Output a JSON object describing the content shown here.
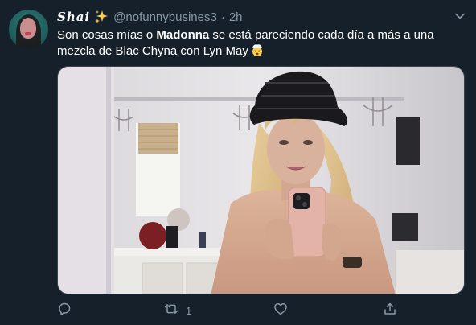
{
  "tweet": {
    "display_name": "Shai",
    "name_emoji": "sparkles-icon",
    "handle": "@nofunnybusines3",
    "separator": "·",
    "time": "2h",
    "text_before": "Son cosas mías o ",
    "text_bold": "Madonna",
    "text_after": " se está pareciendo cada día a más a una mezcla de Blac Chyna con Lyn May",
    "text_emoji": "exploding-head-icon",
    "media_description_icon": "photo-icon"
  },
  "actions": {
    "reply": {
      "icon": "reply-icon",
      "count": ""
    },
    "retweet": {
      "icon": "retweet-icon",
      "count": "1"
    },
    "like": {
      "icon": "heart-icon",
      "count": ""
    },
    "share": {
      "icon": "share-icon",
      "count": ""
    }
  },
  "colors": {
    "background": "#15202b",
    "secondary_text": "#8899a6",
    "primary_text": "#ffffff",
    "border": "#38444d"
  }
}
